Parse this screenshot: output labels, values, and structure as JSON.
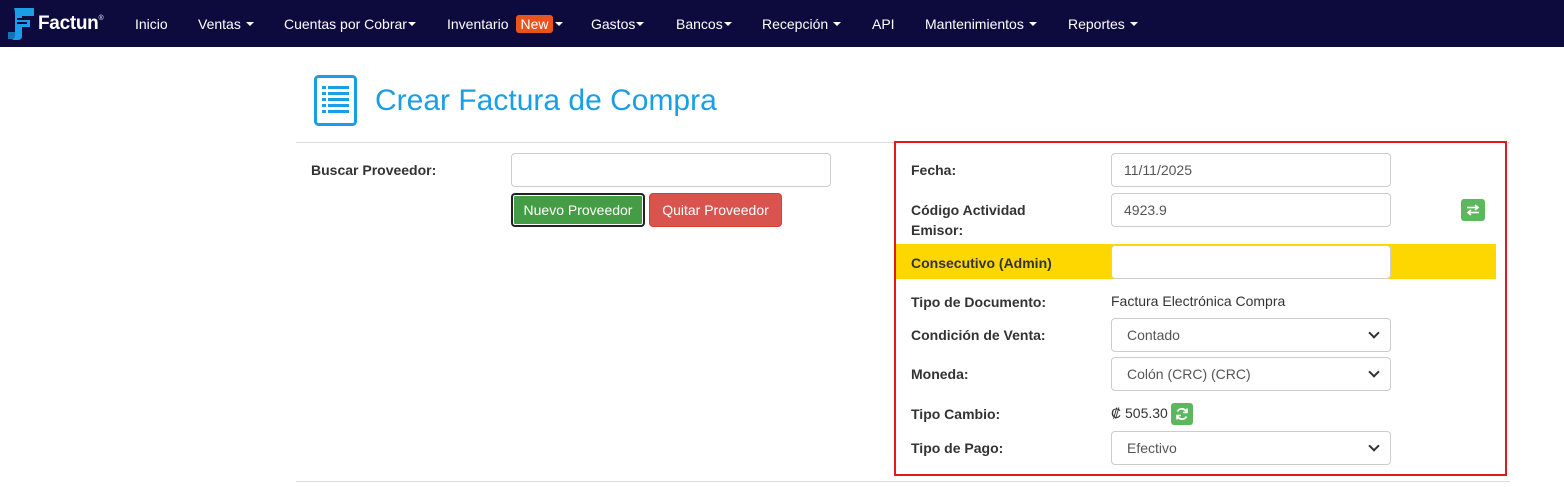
{
  "nav": {
    "brand": "Factun",
    "brand_reg": "®",
    "items": [
      {
        "label": "Inicio"
      },
      {
        "label": "Ventas"
      },
      {
        "label": "Cuentas por Cobrar"
      },
      {
        "label": "Inventario",
        "badge": "New"
      },
      {
        "label": "Gastos"
      },
      {
        "label": "Bancos"
      },
      {
        "label": "Recepción"
      },
      {
        "label": "API"
      },
      {
        "label": "Mantenimientos"
      },
      {
        "label": "Reportes"
      }
    ]
  },
  "page": {
    "title": "Crear Factura de Compra",
    "icon": "document-list-icon"
  },
  "supplier": {
    "search_label": "Buscar Proveedor:",
    "search_value": "",
    "new_button": "Nuevo Proveedor",
    "remove_button": "Quitar Proveedor"
  },
  "invoice": {
    "fecha_label": "Fecha:",
    "fecha_value": "11/11/2025",
    "actividad_label_1": "Código Actividad",
    "actividad_label_2": "Emisor:",
    "actividad_value": "4923.9",
    "consecutivo_label": "Consecutivo (Admin)",
    "consecutivo_value": "",
    "tipo_doc_label": "Tipo de Documento:",
    "tipo_doc_value": "Factura Electrónica Compra",
    "condicion_label": "Condición de Venta:",
    "condicion_value": "Contado",
    "moneda_label": "Moneda:",
    "moneda_value": "Colón (CRC) (CRC)",
    "tipo_cambio_label": "Tipo Cambio:",
    "tipo_cambio_value": "₡ 505.30",
    "tipo_pago_label": "Tipo de Pago:",
    "tipo_pago_value": "Efectivo"
  },
  "colors": {
    "navbar": "#0d0b3d",
    "title": "#1a9ee5",
    "highlight_box": "#e01b1b",
    "yellow_band": "#ffd700",
    "badge_new": "#e8541b"
  }
}
